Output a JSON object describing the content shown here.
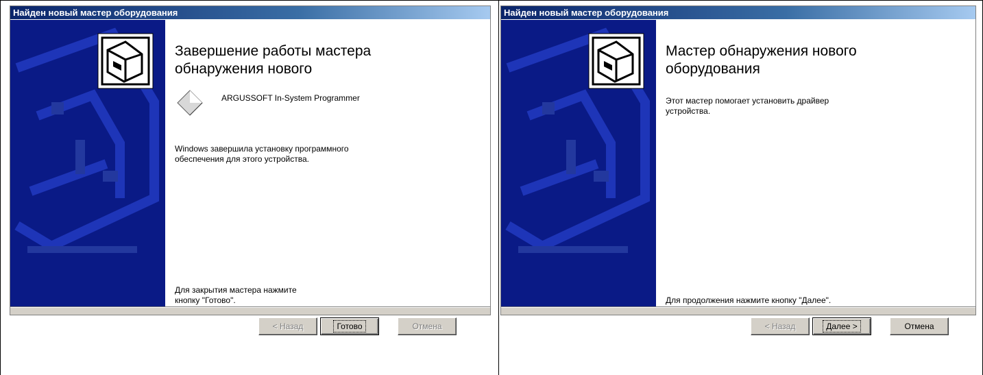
{
  "wizards": [
    {
      "title": "Найден новый мастер оборудования",
      "heading_line1": "Завершение работы мастера",
      "heading_line2": "обнаружения нового",
      "device_name": "ARGUSSOFT In-System Programmer",
      "body_line1": "Windows завершила установку программного",
      "body_line2": "обеспечения для этого устройства.",
      "footer_line1": "Для закрытия мастера нажмите",
      "footer_line2": "кнопку \"Готово\".",
      "back_label": "< Назад",
      "primary_label": "Готово",
      "cancel_label": "Отмена",
      "cancel_enabled": false
    },
    {
      "title": "Найден новый мастер оборудования",
      "heading_line1": "Мастер обнаружения нового",
      "heading_line2": "оборудования",
      "body_line1": "Этот мастер помогает установить драйвер",
      "body_line2": "устройства.",
      "footer_line1": "Для продолжения нажмите кнопку \"Далее\".",
      "back_label": "< Назад",
      "primary_label": "Далее >",
      "cancel_label": "Отмена",
      "cancel_enabled": true
    }
  ],
  "colors": {
    "sidebar": "#0a1a86",
    "titlebar_start": "#0a246a",
    "titlebar_end": "#a6caf0",
    "button_face": "#d4d0c8"
  }
}
